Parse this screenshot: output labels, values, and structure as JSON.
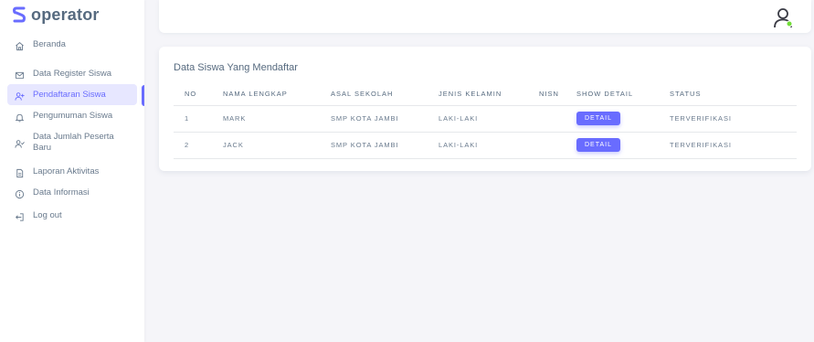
{
  "brand": {
    "name": "operator",
    "logo_icon": "s-logo-icon",
    "logo_color": "#696cff"
  },
  "sidebar": {
    "items": [
      {
        "label": "Beranda",
        "icon": "home-icon",
        "active": false
      },
      {
        "label": "Data Register Siswa",
        "icon": "mail-icon",
        "active": false
      },
      {
        "label": "Pendaftaran Siswa",
        "icon": "user-plus-icon",
        "active": true
      },
      {
        "label": "Pengumuman Siswa",
        "icon": "bell-icon",
        "active": false
      },
      {
        "label": "Data Jumlah Peserta Baru",
        "icon": "user-check-icon",
        "active": false
      },
      {
        "label": "Laporan Aktivitas",
        "icon": "file-icon",
        "active": false
      },
      {
        "label": "Data Informasi",
        "icon": "info-icon",
        "active": false
      },
      {
        "label": "Log out",
        "icon": "log-out-icon",
        "active": false
      }
    ]
  },
  "header": {
    "avatar_icon": "user-avatar-icon"
  },
  "card": {
    "title": "Data Siswa Yang Mendaftar",
    "columns": [
      "NO",
      "NAMA LENGKAP",
      "ASAL SEKOLAH",
      "JENIS KELAMIN",
      "NISN",
      "SHOW DETAIL",
      "STATUS"
    ],
    "rows": [
      {
        "no": "1",
        "nama": "MARK",
        "asal": "SMP KOTA JAMBI",
        "jk": "LAKI-LAKI",
        "nisn": "",
        "detail": "DETAIL",
        "status": "TERVERIFIKASI"
      },
      {
        "no": "2",
        "nama": "JACK",
        "asal": "SMP KOTA JAMBI",
        "jk": "LAKI-LAKI",
        "nisn": "",
        "detail": "DETAIL",
        "status": "TERVERIFIKASI"
      }
    ]
  },
  "colors": {
    "accent": "#696cff",
    "success": "#71dd37",
    "text": "#697a8d",
    "background": "#f5f5f9"
  }
}
